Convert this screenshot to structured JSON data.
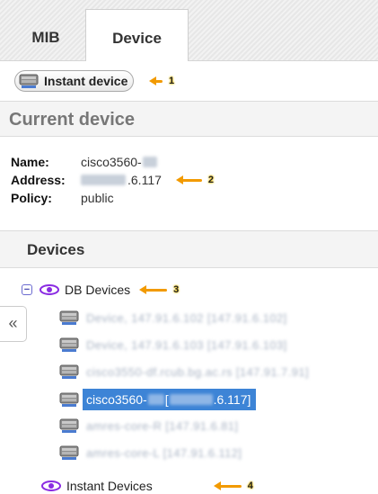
{
  "tabs": [
    {
      "label": "MIB",
      "active": false
    },
    {
      "label": "Device",
      "active": true
    }
  ],
  "instant_device_button": {
    "label": "Instant device"
  },
  "markers": {
    "m1": "1",
    "m2": "2",
    "m3": "3",
    "m4": "4"
  },
  "current_device": {
    "title": "Current device",
    "name_label": "Name:",
    "name_value": "cisco3560-",
    "address_label": "Address:",
    "address_value": ".6.117",
    "policy_label": "Policy:",
    "policy_value": "public"
  },
  "devices": {
    "title": "Devices",
    "collapse_icon": "«",
    "db_group": {
      "label": "DB Devices",
      "toggle": "−"
    },
    "items": [
      {
        "label": "Device, 147.91.6.102 [147.91.6.102]",
        "blurred": true
      },
      {
        "label": "Device, 147.91.6.103 [147.91.6.103]",
        "blurred": true
      },
      {
        "label": "cisco3550-df.rcub.bg.ac.rs [147.91.7.91]",
        "blurred": true
      },
      {
        "label_prefix": "cisco3560-",
        "label_mid": " [",
        "label_suffix": ".6.117]",
        "selected": true
      },
      {
        "label": "amres-core-R [147.91.6.81]",
        "blurred": true
      },
      {
        "label": "amres-core-L [147.91.6.112]",
        "blurred": true
      }
    ],
    "instant_group": {
      "label": "Instant Devices"
    }
  },
  "colors": {
    "accent": "#f29a00",
    "selection": "#3d84d6",
    "eye": "#8a2be2"
  }
}
